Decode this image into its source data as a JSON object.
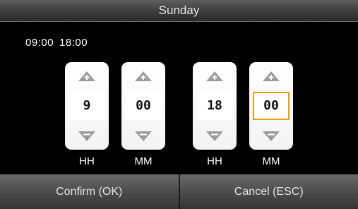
{
  "title": "Sunday",
  "time_range": {
    "start": "09:00",
    "end": "18:00"
  },
  "spinners": [
    {
      "value": "9",
      "unit": "HH"
    },
    {
      "value": "00",
      "unit": "MM"
    },
    {
      "value": "18",
      "unit": "HH"
    },
    {
      "value": "00",
      "unit": "MM"
    }
  ],
  "focused_spinner": 3,
  "buttons": {
    "confirm": "Confirm (OK)",
    "cancel": "Cancel (ESC)"
  },
  "icons": {
    "up": "arrow-up-icon",
    "down": "arrow-down-icon"
  },
  "colors": {
    "focus": "#e7a20b",
    "background": "#000000",
    "arrow": "#9c9c9c"
  }
}
